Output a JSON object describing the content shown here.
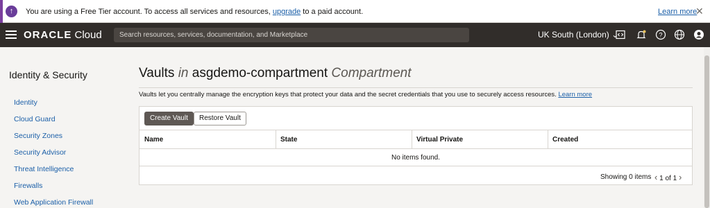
{
  "banner": {
    "text_before": "You are using a Free Tier account. To access all services and resources, ",
    "upgrade_link": "upgrade",
    "text_after": " to a paid account.",
    "learn_more": "Learn more",
    "info_icon": "upload-arrow-icon",
    "close_icon": "close-icon"
  },
  "header": {
    "logo_brand": "ORACLE",
    "logo_product": " Cloud",
    "search_placeholder": "Search resources, services, documentation, and Marketplace",
    "region": "UK South (London)",
    "icons": [
      "code-editor-icon",
      "bell-icon",
      "help-icon",
      "globe-icon",
      "user-icon"
    ]
  },
  "sidebar": {
    "title": "Identity & Security",
    "items": [
      {
        "label": "Identity"
      },
      {
        "label": "Cloud Guard"
      },
      {
        "label": "Security Zones"
      },
      {
        "label": "Security Advisor"
      },
      {
        "label": "Threat Intelligence"
      },
      {
        "label": "Firewalls"
      },
      {
        "label": "Web Application Firewall"
      }
    ]
  },
  "main": {
    "title_prefix": "Vaults ",
    "title_in": "in",
    "title_compartment": " asgdemo-compartment ",
    "title_suffix": "Compartment",
    "description": "Vaults let you centrally manage the encryption keys that protect your data and the secret credentials that you use to securely access resources. ",
    "description_link": "Learn more",
    "create_button": "Create Vault",
    "restore_button": "Restore Vault",
    "table": {
      "columns": [
        "Name",
        "State",
        "Virtual Private",
        "Created"
      ],
      "empty_text": "No items found."
    },
    "showing": "Showing 0 items",
    "pager": "1 of 1"
  },
  "colors": {
    "accent_purple": "#6a3d9a",
    "header_bg": "#312d2a",
    "link": "#1b5fa8",
    "primary_button": "#5e5854"
  }
}
